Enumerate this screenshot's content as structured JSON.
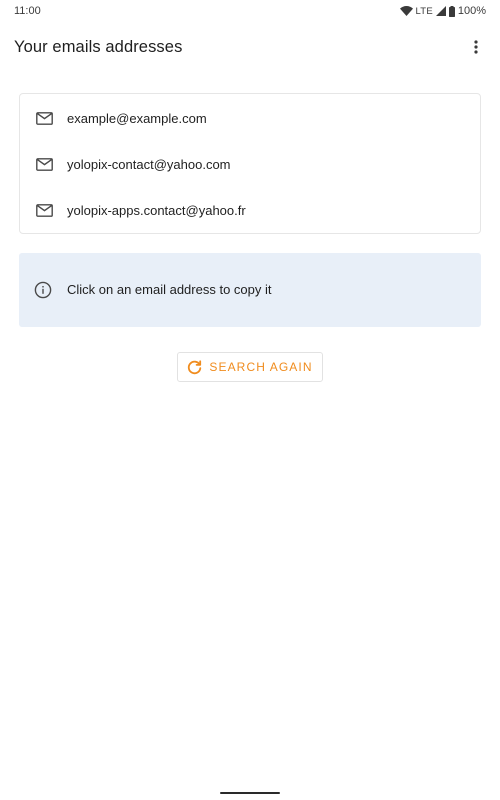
{
  "status_bar": {
    "time": "11:00",
    "network": "LTE",
    "battery": "100%",
    "icons": [
      "wifi-icon",
      "signal-icon",
      "battery-icon"
    ]
  },
  "app_bar": {
    "title": "Your emails addresses",
    "menu_icon": "more-vert-icon"
  },
  "emails": [
    {
      "address": "example@example.com",
      "icon": "mail-icon"
    },
    {
      "address": "yolopix-contact@yahoo.com",
      "icon": "mail-icon"
    },
    {
      "address": "yolopix-apps.contact@yahoo.fr",
      "icon": "mail-icon"
    }
  ],
  "info": {
    "text": "Click on an email address to copy it",
    "icon": "info-icon"
  },
  "search_button": {
    "label": "SEARCH AGAIN",
    "icon": "refresh-icon"
  },
  "colors": {
    "accent": "#f08c1e",
    "info_background": "#e8eff8",
    "card_border": "#e6e6e6",
    "text": "#1f1f1f"
  }
}
